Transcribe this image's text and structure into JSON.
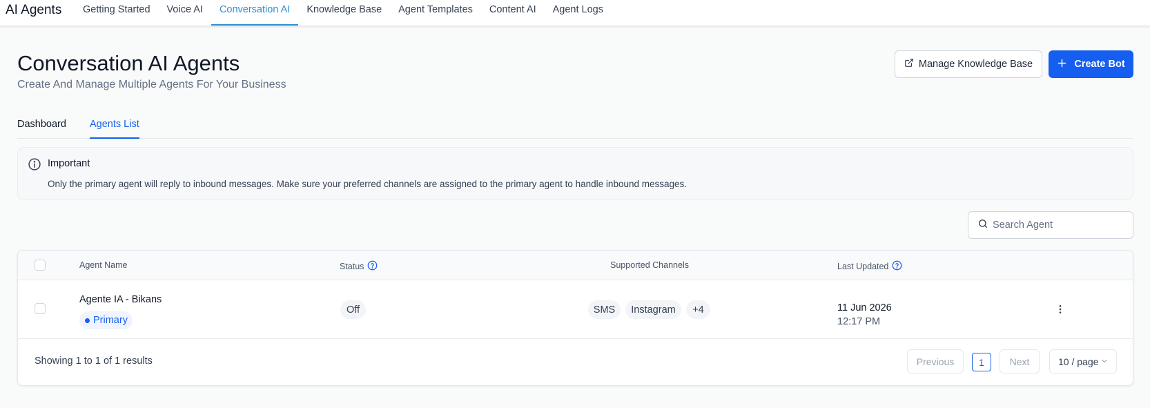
{
  "app": {
    "brand": "AI Agents"
  },
  "nav": {
    "tabs": [
      {
        "label": "Getting Started"
      },
      {
        "label": "Voice AI"
      },
      {
        "label": "Conversation AI",
        "active": true
      },
      {
        "label": "Knowledge Base"
      },
      {
        "label": "Agent Templates"
      },
      {
        "label": "Content AI"
      },
      {
        "label": "Agent Logs"
      }
    ]
  },
  "header": {
    "title": "Conversation AI Agents",
    "subtitle": "Create And Manage Multiple Agents For Your Business",
    "manage_kb_label": "Manage Knowledge Base",
    "create_bot_label": "Create Bot"
  },
  "subtabs": [
    {
      "label": "Dashboard"
    },
    {
      "label": "Agents List",
      "active": true
    }
  ],
  "alert": {
    "title": "Important",
    "text": "Only the primary agent will reply to inbound messages. Make sure your preferred channels are assigned to the primary agent to handle inbound messages."
  },
  "search": {
    "placeholder": "Search Agent",
    "value": ""
  },
  "table": {
    "columns": {
      "agent_name": "Agent Name",
      "status": "Status",
      "channels": "Supported Channels",
      "last_updated": "Last Updated"
    },
    "rows": [
      {
        "name": "Agente IA - Bikans",
        "badge": "Primary",
        "status": "Off",
        "channels": [
          "SMS",
          "Instagram"
        ],
        "more_channels": "+4",
        "date": "11 Jun 2026",
        "time": "12:17 PM"
      }
    ],
    "footer": {
      "summary": "Showing 1 to 1 of 1 results",
      "previous": "Previous",
      "next": "Next",
      "current_page": "1",
      "per_page": "10 / page"
    }
  },
  "colors": {
    "accent": "#155eef",
    "nav_active": "#2e90d3",
    "text": "#101828"
  }
}
